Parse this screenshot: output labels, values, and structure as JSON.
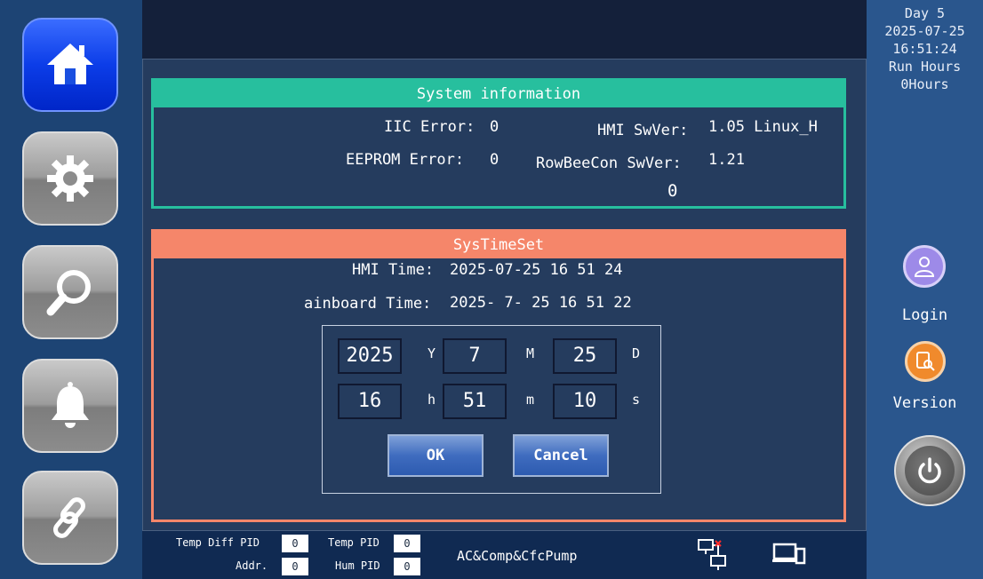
{
  "nav": {
    "items": [
      {
        "name": "home",
        "icon": "home-icon",
        "active": true
      },
      {
        "name": "settings",
        "icon": "gear-icon",
        "active": false
      },
      {
        "name": "search",
        "icon": "search-icon",
        "active": false
      },
      {
        "name": "alarm",
        "icon": "bell-icon",
        "active": false
      },
      {
        "name": "link",
        "icon": "link-icon",
        "active": false
      }
    ]
  },
  "status": {
    "day": "Day  5",
    "date": "2025-07-25",
    "time": "16:51:24",
    "run_hours_label": "Run Hours",
    "run_hours_value": "0Hours",
    "login_label": "Login",
    "version_label": "Version"
  },
  "system_info": {
    "title": "System information",
    "iic_label": "IIC Error:",
    "iic_value": "0",
    "eeprom_label": "EEPROM Error:",
    "eeprom_value": "0",
    "hmi_swver_label": "HMI SwVer:",
    "hmi_swver_value": "1.05 Linux_H",
    "rowbeecon_label": "RowBeeCon SwVer:",
    "rowbeecon_value": "1.21",
    "extra_value": "0"
  },
  "time_set": {
    "title": "SysTimeSet",
    "hmi_time_label": "HMI Time:",
    "hmi_time_value": "2025-07-25 16 51 24",
    "mainboard_time_label": "ainboard Time:",
    "mainboard_time_value": "2025- 7- 25 16 51 22",
    "fields": {
      "year": "2025",
      "year_unit": "Y",
      "month": "7",
      "month_unit": "M",
      "day": "25",
      "day_unit": "D",
      "hour": "16",
      "hour_unit": "h",
      "minute": "51",
      "minute_unit": "m",
      "second": "10",
      "second_unit": "s"
    },
    "ok_label": "OK",
    "cancel_label": "Cancel"
  },
  "bottom": {
    "temp_diff_pid_label": "Temp Diff PID",
    "temp_diff_pid_value": "0",
    "addr_label": "Addr.",
    "addr_value": "0",
    "temp_pid_label": "Temp PID",
    "temp_pid_value": "0",
    "hum_pid_label": "Hum PID",
    "hum_pid_value": "0",
    "mode_text": "AC&Comp&CfcPump"
  },
  "colors": {
    "accent_teal": "#27bf9e",
    "accent_salmon": "#f5866a",
    "active_blue": "#0c3de8"
  }
}
